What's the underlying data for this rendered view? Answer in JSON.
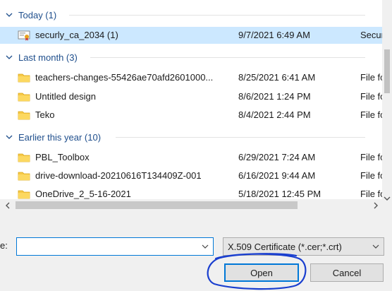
{
  "groups": [
    {
      "label": "Today (1)"
    },
    {
      "label": "Last month (3)"
    },
    {
      "label": "Earlier this year (10)"
    }
  ],
  "files": [
    {
      "name": "securly_ca_2034 (1)",
      "date": "9/7/2021 6:49 AM",
      "type": "Secur",
      "icon": "certificate-file-icon",
      "selected": true
    },
    {
      "name": "teachers-changes-55426ae70afd2601000...",
      "date": "8/25/2021 6:41 AM",
      "type": "File fo",
      "icon": "folder-icon"
    },
    {
      "name": "Untitled design",
      "date": "8/6/2021 1:24 PM",
      "type": "File fo",
      "icon": "folder-icon"
    },
    {
      "name": "Teko",
      "date": "8/4/2021 2:44 PM",
      "type": "File fo",
      "icon": "folder-icon"
    },
    {
      "name": "PBL_Toolbox",
      "date": "6/29/2021 7:24 AM",
      "type": "File fo",
      "icon": "folder-icon"
    },
    {
      "name": "drive-download-20210616T134409Z-001",
      "date": "6/16/2021 9:44 AM",
      "type": "File fo",
      "icon": "folder-icon"
    },
    {
      "name": "OneDrive_2_5-16-2021",
      "date": "5/18/2021 12:45 PM",
      "type": "File fo",
      "icon": "folder-icon"
    }
  ],
  "filename": {
    "label": "e:",
    "value": ""
  },
  "file_type_filter": {
    "selected": "X.509 Certificate (*.cer;*.crt)"
  },
  "buttons": {
    "open": "Open",
    "cancel": "Cancel"
  },
  "colors": {
    "selection": "#cce8ff",
    "group_header": "#1e4e8c",
    "accent": "#0078d7",
    "annotation": "#1a3fcf"
  }
}
